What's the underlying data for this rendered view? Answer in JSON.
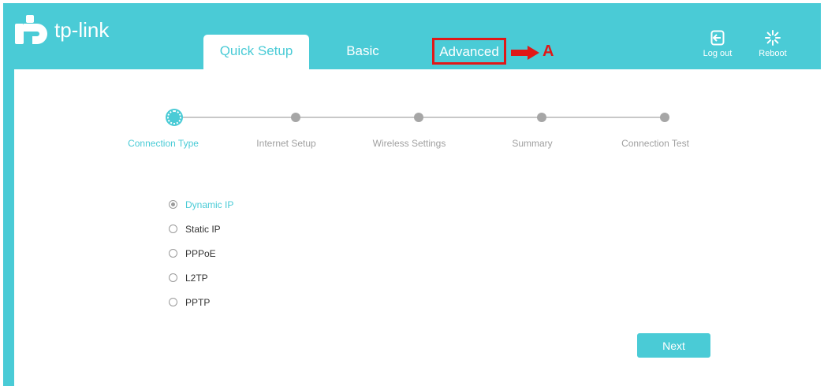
{
  "brand": {
    "name": "tp-link"
  },
  "tabs": [
    {
      "label": "Quick Setup",
      "active": true
    },
    {
      "label": "Basic",
      "active": false
    },
    {
      "label": "Advanced",
      "active": false
    }
  ],
  "annotation": {
    "letter": "A"
  },
  "toolbar": {
    "logout_label": "Log out",
    "reboot_label": "Reboot"
  },
  "steps": [
    {
      "label": "Connection Type",
      "active": true
    },
    {
      "label": "Internet Setup",
      "active": false
    },
    {
      "label": "Wireless Settings",
      "active": false
    },
    {
      "label": "Summary",
      "active": false
    },
    {
      "label": "Connection Test",
      "active": false
    }
  ],
  "connection_types": [
    {
      "label": "Dynamic IP",
      "selected": true
    },
    {
      "label": "Static IP",
      "selected": false
    },
    {
      "label": "PPPoE",
      "selected": false
    },
    {
      "label": "L2TP",
      "selected": false
    },
    {
      "label": "PPTP",
      "selected": false
    }
  ],
  "next_label": "Next",
  "colors": {
    "accent": "#4acbd6",
    "annotation": "#e01818",
    "inactive": "#a6a6a6"
  }
}
